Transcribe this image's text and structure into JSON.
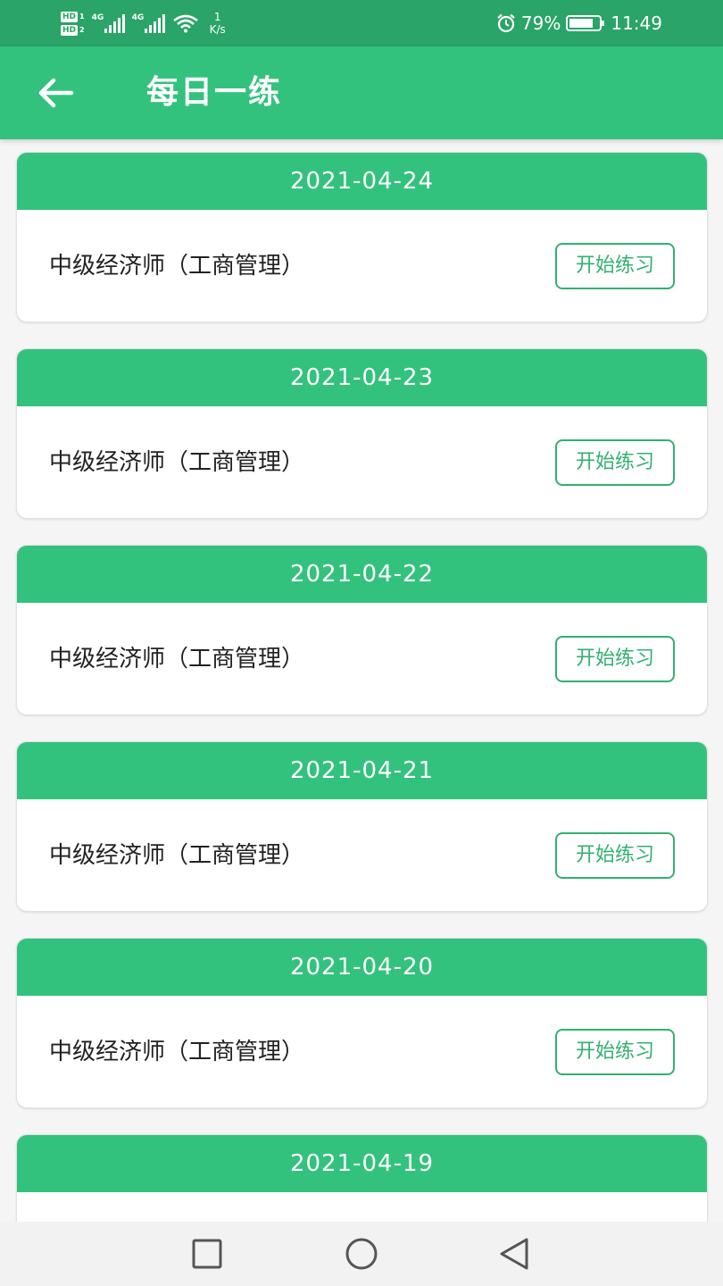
{
  "status_bar": {
    "hd1": "HD",
    "hd1_num": "1",
    "hd2": "HD",
    "hd2_num": "2",
    "net1": "4G",
    "net2": "4G",
    "speed_value": "1",
    "speed_unit": "K/s",
    "battery_percent": "79%",
    "time": "11:49",
    "icons": [
      "signal-icon",
      "wifi-icon",
      "alarm-icon",
      "battery-icon"
    ]
  },
  "app_bar": {
    "title": "每日一练",
    "back_icon": "arrow-left-icon"
  },
  "cards": [
    {
      "date": "2021-04-24",
      "course": "中级经济师（工商管理）",
      "button": "开始练习"
    },
    {
      "date": "2021-04-23",
      "course": "中级经济师（工商管理）",
      "button": "开始练习"
    },
    {
      "date": "2021-04-22",
      "course": "中级经济师（工商管理）",
      "button": "开始练习"
    },
    {
      "date": "2021-04-21",
      "course": "中级经济师（工商管理）",
      "button": "开始练习"
    },
    {
      "date": "2021-04-20",
      "course": "中级经济师（工商管理）",
      "button": "开始练习"
    },
    {
      "date": "2021-04-19",
      "course": "",
      "button": ""
    }
  ],
  "nav_bar": {
    "icons": [
      "recents-square-icon",
      "home-circle-icon",
      "back-triangle-icon"
    ]
  },
  "colors": {
    "status_bar": "#2aa468",
    "primary": "#33c27d",
    "button_text": "#33b06f",
    "background": "#f5f5f5"
  }
}
